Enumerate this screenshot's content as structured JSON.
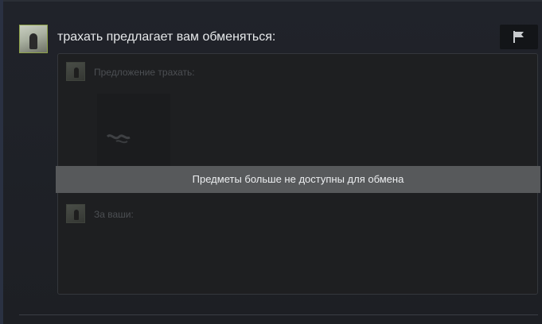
{
  "offer": {
    "headline": "трахать предлагает вам обменяться:",
    "their_section_label": "Предложение трахать:",
    "your_section_label": "За ваши:",
    "unavailable_message": "Предметы больше не доступны для обмена"
  },
  "icons": {
    "report": "flag-icon",
    "item_placeholder": "broken-item-icon"
  },
  "colors": {
    "page_background": "#1d1f24",
    "trade_box_background": "#1e1f21",
    "banner_background": "#57595b",
    "avatar_border": "#8fa34a"
  }
}
